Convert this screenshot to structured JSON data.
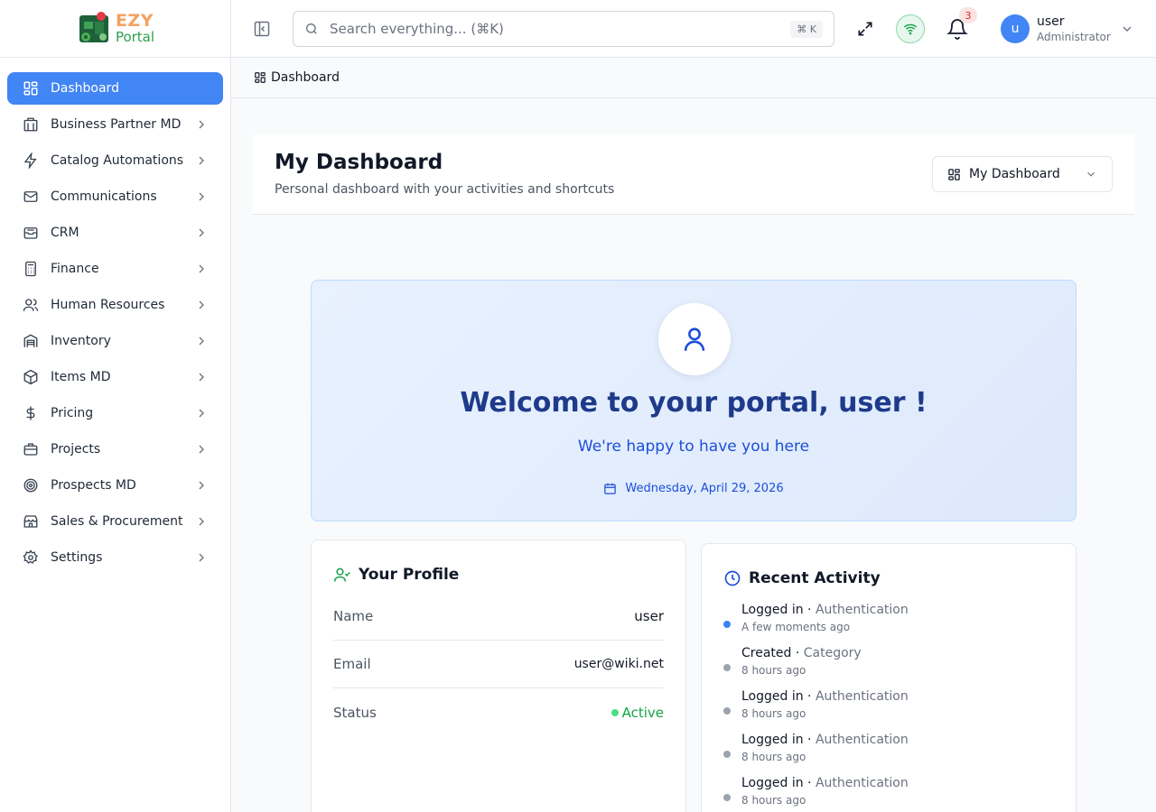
{
  "brand": {
    "line1": "EZY",
    "line2": "Portal"
  },
  "sidebar": {
    "items": [
      {
        "label": "Dashboard",
        "icon": "dashboard-grid-icon",
        "active": true
      },
      {
        "label": "Business Partner MD",
        "icon": "building-icon"
      },
      {
        "label": "Catalog Automations",
        "icon": "lightning-icon"
      },
      {
        "label": "Communications",
        "icon": "mail-icon"
      },
      {
        "label": "CRM",
        "icon": "inbox-icon"
      },
      {
        "label": "Finance",
        "icon": "calculator-icon"
      },
      {
        "label": "Human Resources",
        "icon": "users-icon"
      },
      {
        "label": "Inventory",
        "icon": "warehouse-icon"
      },
      {
        "label": "Items MD",
        "icon": "box-icon"
      },
      {
        "label": "Pricing",
        "icon": "dollar-icon"
      },
      {
        "label": "Projects",
        "icon": "briefcase-icon"
      },
      {
        "label": "Prospects MD",
        "icon": "target-icon"
      },
      {
        "label": "Sales & Procurement",
        "icon": "store-icon"
      },
      {
        "label": "Settings",
        "icon": "gear-icon"
      }
    ]
  },
  "topbar": {
    "search_placeholder": "Search everything... (⌘K)",
    "search_shortcut": "⌘ K",
    "notification_count": "3",
    "user": {
      "initial": "u",
      "name": "user",
      "role": "Administrator"
    }
  },
  "breadcrumb": {
    "label": "Dashboard"
  },
  "header": {
    "title": "My Dashboard",
    "subtitle": "Personal dashboard with your activities and shortcuts",
    "selector_value": "My Dashboard"
  },
  "welcome": {
    "title": "Welcome to your portal, user !",
    "subtitle": "We're happy to have you here",
    "date": "Wednesday, April 29, 2026"
  },
  "profile": {
    "title": "Your Profile",
    "rows": [
      {
        "label": "Name",
        "value": "user"
      },
      {
        "label": "Email",
        "value": "user@wiki.net"
      },
      {
        "label": "Status",
        "value": "Active"
      }
    ]
  },
  "activity": {
    "title": "Recent Activity",
    "items": [
      {
        "action": "Logged in",
        "category": "Authentication",
        "time": "A few moments ago",
        "highlight": true
      },
      {
        "action": "Created",
        "category": "Category",
        "time": "8 hours ago"
      },
      {
        "action": "Logged in",
        "category": "Authentication",
        "time": "8 hours ago"
      },
      {
        "action": "Logged in",
        "category": "Authentication",
        "time": "8 hours ago"
      },
      {
        "action": "Logged in",
        "category": "Authentication",
        "time": "8 hours ago"
      }
    ]
  },
  "colors": {
    "accent": "#4285f4",
    "welcome_title": "#1e3a8a",
    "status_active": "#16a34a",
    "brand_orange": "#f4a261",
    "brand_green": "#2e9e4f"
  }
}
